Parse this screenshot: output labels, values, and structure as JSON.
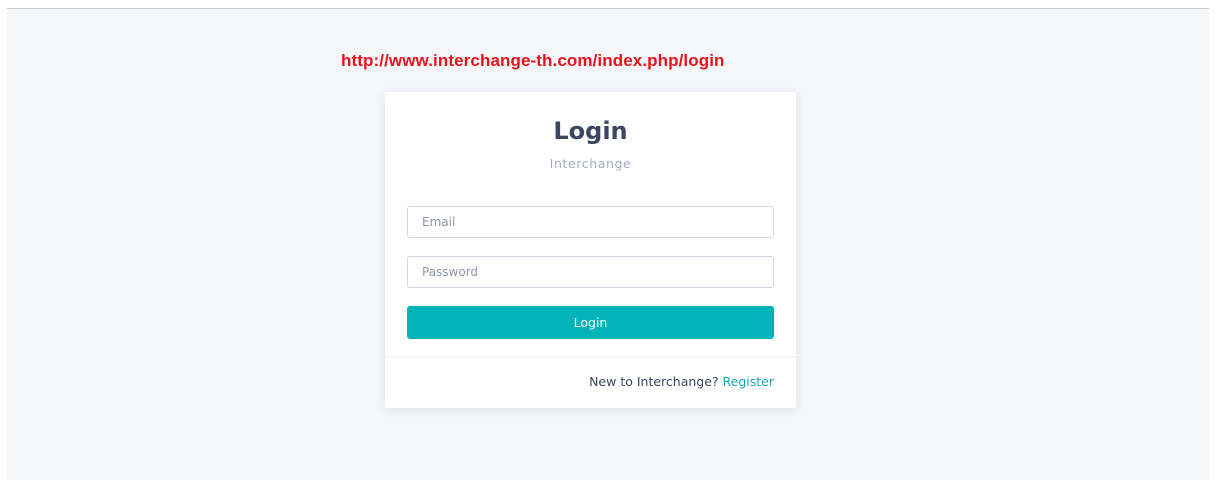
{
  "caption": {
    "url_text": "http://www.interchange-th.com/index.php/login",
    "color": "#e8141c"
  },
  "login_card": {
    "title": "Login",
    "subtitle": "Interchange",
    "email": {
      "value": "",
      "placeholder": "Email"
    },
    "password": {
      "value": "",
      "placeholder": "Password"
    },
    "submit_label": "Login",
    "footer_text": "New to Interchange?",
    "register_label": "Register"
  },
  "colors": {
    "accent": "#00b4b8",
    "link": "#16a7b3",
    "title": "#3b4660",
    "page_background": "#f4f6fa"
  }
}
